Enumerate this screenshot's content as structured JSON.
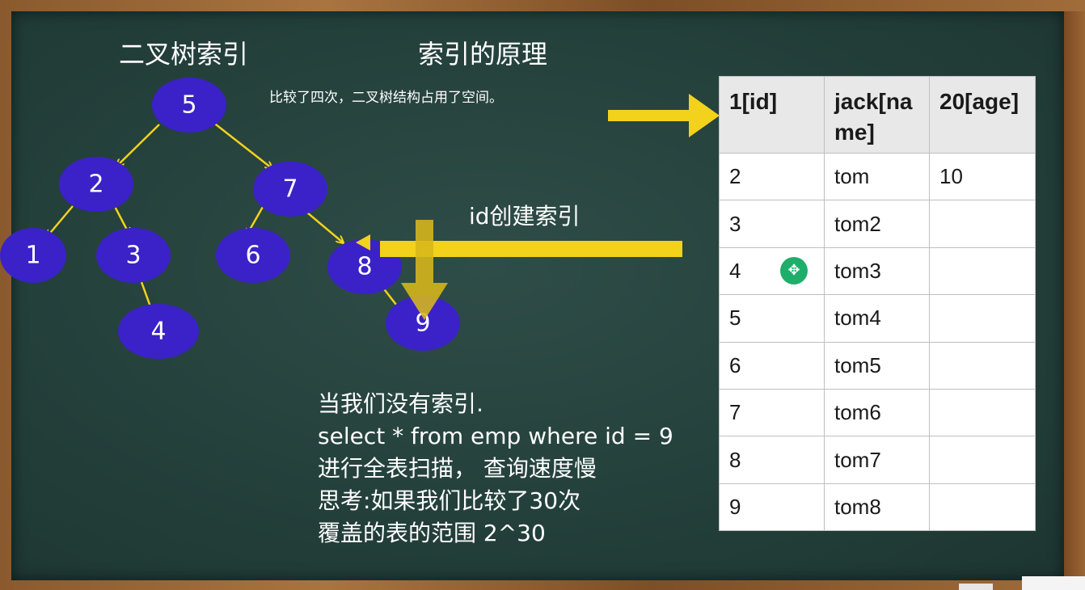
{
  "slide": {
    "title_left": "二叉树索引",
    "title_center": "索引的原理",
    "note": "比较了四次，二叉树结构占用了空间。",
    "id_label": "id创建索引",
    "description": [
      "当我们没有索引.",
      "select * from emp where  id = 9",
      "进行全表扫描， 查询速度慢",
      "思考:如果我们比较了30次",
      "覆盖的表的范围 2^30"
    ]
  },
  "tree": {
    "node_color": "#3a22c8",
    "arrow_color": "#f2d21b",
    "nodes": [
      "5",
      "2",
      "7",
      "1",
      "3",
      "6",
      "8",
      "4",
      "9"
    ]
  },
  "table": {
    "headers": [
      "1[id]",
      "jack[name]",
      "20[age]"
    ],
    "rows": [
      [
        "2",
        "tom",
        "10"
      ],
      [
        "3",
        "tom2",
        ""
      ],
      [
        "4",
        "tom3",
        ""
      ],
      [
        "5",
        "tom4",
        ""
      ],
      [
        "6",
        "tom5",
        ""
      ],
      [
        "7",
        "tom6",
        ""
      ],
      [
        "8",
        "tom7",
        ""
      ],
      [
        "9",
        "tom8",
        ""
      ]
    ]
  },
  "icons": {
    "cursor": "move-cursor-icon"
  }
}
